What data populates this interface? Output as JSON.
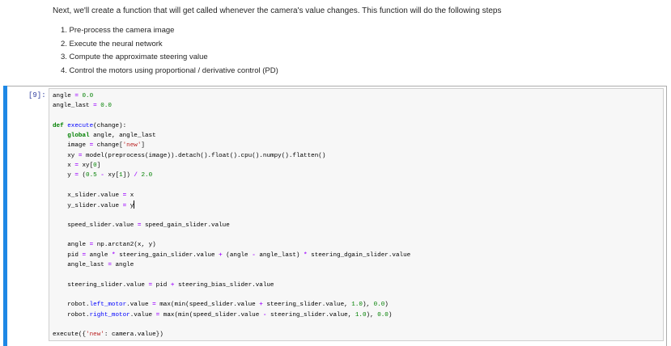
{
  "markdown": {
    "intro": "Next, we'll create a function that will get called whenever the camera's value changes. This function will do the following steps",
    "steps": [
      "1. Pre-process the camera image",
      "2. Execute the neural network",
      "3. Compute the approximate steering value",
      "4. Control the motors using proportional / derivative control (PD)"
    ]
  },
  "cell": {
    "prompt": "[9]:",
    "code_lines": [
      "angle = 0.0",
      "angle_last = 0.0",
      "",
      "def execute(change):",
      "    global angle, angle_last",
      "    image = change['new']",
      "    xy = model(preprocess(image)).detach().float().cpu().numpy().flatten()",
      "    x = xy[0]",
      "    y = (0.5 - xy[1]) / 2.0",
      "",
      "    x_slider.value = x",
      "    y_slider.value = y",
      "",
      "    speed_slider.value = speed_gain_slider.value",
      "",
      "    angle = np.arctan2(x, y)",
      "    pid = angle * steering_gain_slider.value + (angle - angle_last) * steering_dgain_slider.value",
      "    angle_last = angle",
      "",
      "    steering_slider.value = pid + steering_bias_slider.value",
      "",
      "    robot.left_motor.value = max(min(speed_slider.value + steering_slider.value, 1.0), 0.0)",
      "    robot.right_motor.value = max(min(speed_slider.value - steering_slider.value, 1.0), 0.0)",
      "",
      "execute({'new': camera.value})"
    ]
  },
  "colors": {
    "selected_cell_bar": "#1e88e5",
    "prompt": "#303f9f",
    "keyword": "#008000",
    "string": "#ba2121",
    "operator": "#aa22ff",
    "attribute": "#0000ff",
    "input_background": "#f7f7f7"
  }
}
